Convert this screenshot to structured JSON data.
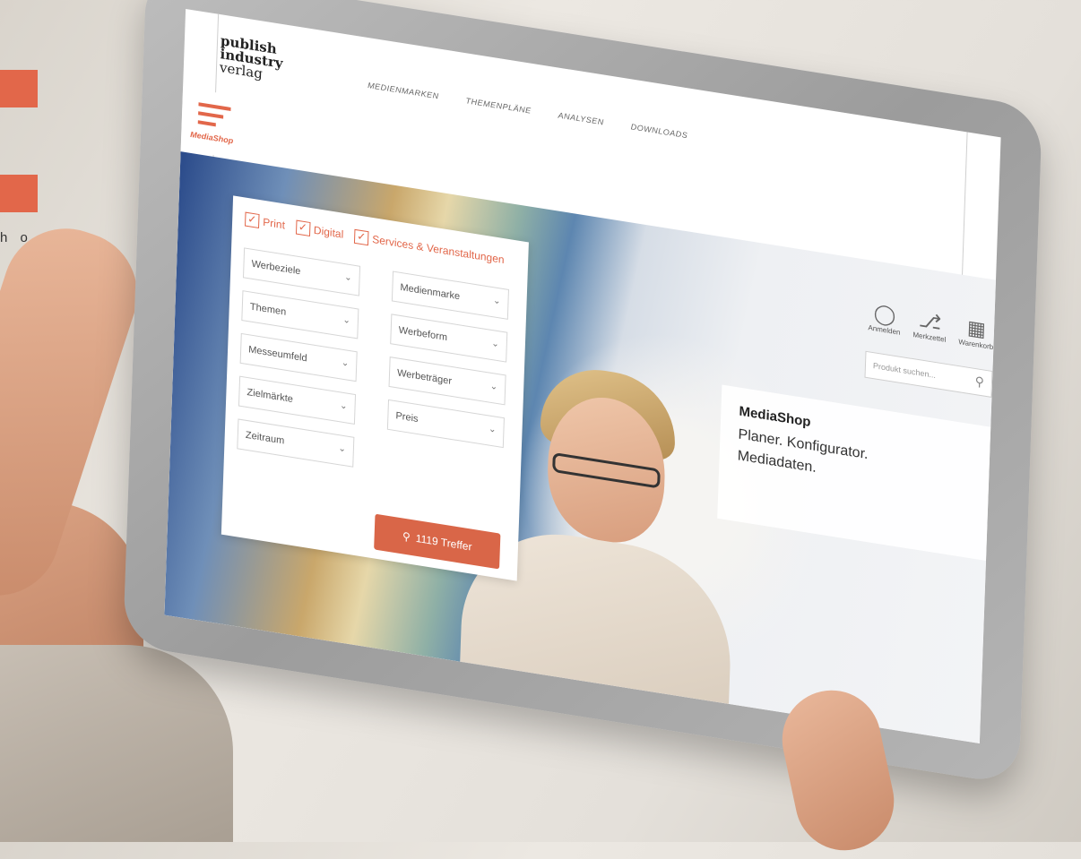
{
  "edge": {
    "text": "h o p",
    "accent": "#e2674a"
  },
  "brand": {
    "line1": "publish",
    "line2": "industry",
    "line3": "verlag"
  },
  "nav": {
    "items": [
      "MEDIENMARKEN",
      "THEMENPLÄNE",
      "ANALYSEN",
      "DOWNLOADS"
    ]
  },
  "shop": {
    "label": "MediaShop"
  },
  "filters": {
    "checks": [
      "Print",
      "Digital",
      "Services & Veranstaltungen"
    ],
    "dropdowns": [
      "Werbeziele",
      "Medienmarke",
      "Themen",
      "Werbeform",
      "Messeumfeld",
      "Werbeträger",
      "Zielmärkte",
      "Preis",
      "Zeitraum"
    ],
    "button": "1119 Treffer"
  },
  "promo": {
    "title": "MediaShop",
    "line1": "Planer. Konfigurator.",
    "line2": "Mediadaten."
  },
  "header_icons": {
    "login": "Anmelden",
    "bookmark": "Merkzettel",
    "cart": "Warenkorb"
  },
  "search": {
    "placeholder": "Produkt suchen..."
  }
}
